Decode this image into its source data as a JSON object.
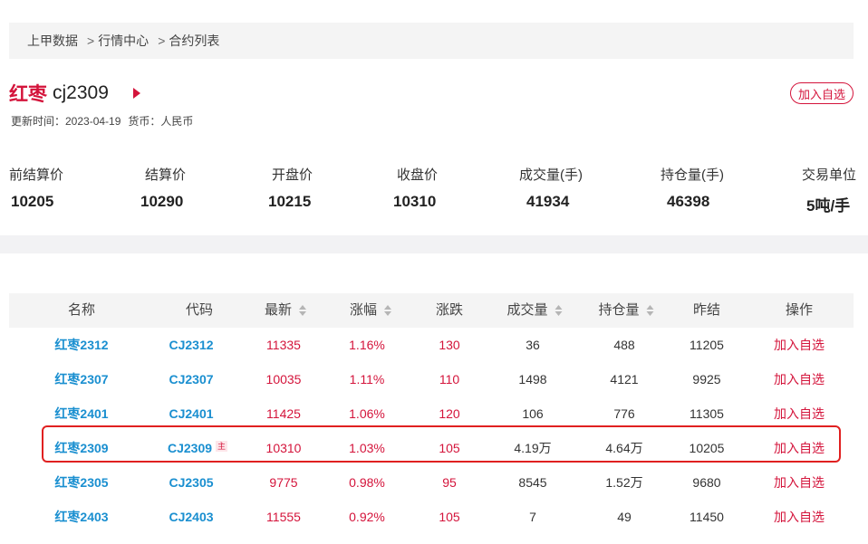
{
  "breadcrumb": {
    "home": "上甲数据",
    "sep": ">",
    "level2": "行情中心",
    "level3": "合约列表"
  },
  "header": {
    "name": "红枣",
    "code": "cj2309",
    "update_time": "更新时间：2023-04-19",
    "currency": "货币：人民币",
    "add_fav": "加入自选"
  },
  "stats": [
    {
      "label": "前结算价",
      "value": "10205"
    },
    {
      "label": "结算价",
      "value": "10290"
    },
    {
      "label": "开盘价",
      "value": "10215"
    },
    {
      "label": "收盘价",
      "value": "10310"
    },
    {
      "label": "成交量(手)",
      "value": "41934"
    },
    {
      "label": "持仓量(手)",
      "value": "46398"
    },
    {
      "label": "交易单位",
      "value": "5吨/手"
    }
  ],
  "table": {
    "headers": [
      "名称",
      "代码",
      "最新",
      "涨幅",
      "涨跌",
      "成交量",
      "持仓量",
      "昨结",
      "操作"
    ],
    "main_tag": "主",
    "rows": [
      {
        "name": "红枣2312",
        "code": "CJ2312",
        "latest": "11335",
        "pct": "1.16%",
        "chg": "130",
        "volume": "36",
        "oi": "488",
        "prev": "11205",
        "action": "加入自选"
      },
      {
        "name": "红枣2307",
        "code": "CJ2307",
        "latest": "10035",
        "pct": "1.11%",
        "chg": "110",
        "volume": "1498",
        "oi": "4121",
        "prev": "9925",
        "action": "加入自选"
      },
      {
        "name": "红枣2401",
        "code": "CJ2401",
        "latest": "11425",
        "pct": "1.06%",
        "chg": "120",
        "volume": "106",
        "oi": "776",
        "prev": "11305",
        "action": "加入自选"
      },
      {
        "name": "红枣2309",
        "code": "CJ2309",
        "latest": "10310",
        "pct": "1.03%",
        "chg": "105",
        "volume": "4.19万",
        "oi": "4.64万",
        "prev": "10205",
        "action": "加入自选"
      },
      {
        "name": "红枣2305",
        "code": "CJ2305",
        "latest": "9775",
        "pct": "0.98%",
        "chg": "95",
        "volume": "8545",
        "oi": "1.52万",
        "prev": "9680",
        "action": "加入自选"
      },
      {
        "name": "红枣2403",
        "code": "CJ2403",
        "latest": "11555",
        "pct": "0.92%",
        "chg": "105",
        "volume": "7",
        "oi": "49",
        "prev": "11450",
        "action": "加入自选"
      }
    ]
  },
  "colors": {
    "accent_red": "#d4143b",
    "link_blue": "#1a8fd0",
    "highlight_border": "#e02020"
  }
}
